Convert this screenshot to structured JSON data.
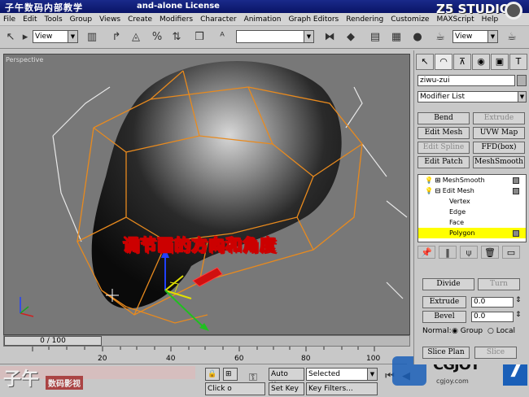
{
  "titlebar": {
    "title": "子午数码内部教学",
    "suffix": "and-alone License",
    "logo_text": "Z5 STUDIO"
  },
  "menu": [
    "File",
    "Edit",
    "Tools",
    "Group",
    "Views",
    "Create",
    "Modifiers",
    "Character",
    "Animation",
    "Graph Editors",
    "Rendering",
    "Customize",
    "MAXScript",
    "Help"
  ],
  "toolbar": {
    "view_dropdown_left": "View",
    "view_dropdown_right": "View",
    "named_selection": ""
  },
  "viewport": {
    "label": "Perspective",
    "caption": "调节面的方向和角度"
  },
  "timeslider": {
    "frame_text": "0 / 100",
    "ticks": [
      "20",
      "40",
      "60",
      "80",
      "100"
    ]
  },
  "status": {
    "brand": "子午",
    "brand2": "数码影视",
    "auto_key": "Auto Key",
    "selected": "Selected",
    "set_key": "Set Key",
    "key_filters": "Key Filters...",
    "click_hint": "Click o",
    "watermark": "cgjoy.com"
  },
  "panel": {
    "object_name": "ziwu-zui",
    "modifier_list": "Modifier List",
    "mod_buttons": [
      {
        "label": "Bend",
        "disabled": false
      },
      {
        "label": "Extrude",
        "disabled": true
      },
      {
        "label": "Edit Mesh",
        "disabled": false
      },
      {
        "label": "UVW Map",
        "disabled": false
      },
      {
        "label": "Edit Spline",
        "disabled": true
      },
      {
        "label": "FFD(box)",
        "disabled": false
      },
      {
        "label": "Edit Patch",
        "disabled": false
      },
      {
        "label": "MeshSmooth",
        "disabled": false
      }
    ],
    "stack": [
      {
        "label": "MeshSmooth",
        "type": "modifier"
      },
      {
        "label": "Edit Mesh",
        "type": "modifier"
      },
      {
        "label": "Vertex",
        "type": "sub"
      },
      {
        "label": "Edge",
        "type": "sub"
      },
      {
        "label": "Face",
        "type": "sub"
      },
      {
        "label": "Polygon",
        "type": "sub-selected"
      }
    ],
    "divide_label": "Divide",
    "turn_label": "Turn",
    "extrude_label": "Extrude",
    "extrude_value": "0.0",
    "bevel_label": "Bevel",
    "bevel_value": "0.0",
    "normal_label": "Normal:",
    "normal_group": "Group",
    "normal_local": "Local",
    "slice_plane": "Slice Plan",
    "slice": "Slice"
  },
  "colors": {
    "title_bg": "#0a1466",
    "viewport_bg": "#787878",
    "cage": "#e88a1e",
    "selected_row": "#ffff00"
  }
}
